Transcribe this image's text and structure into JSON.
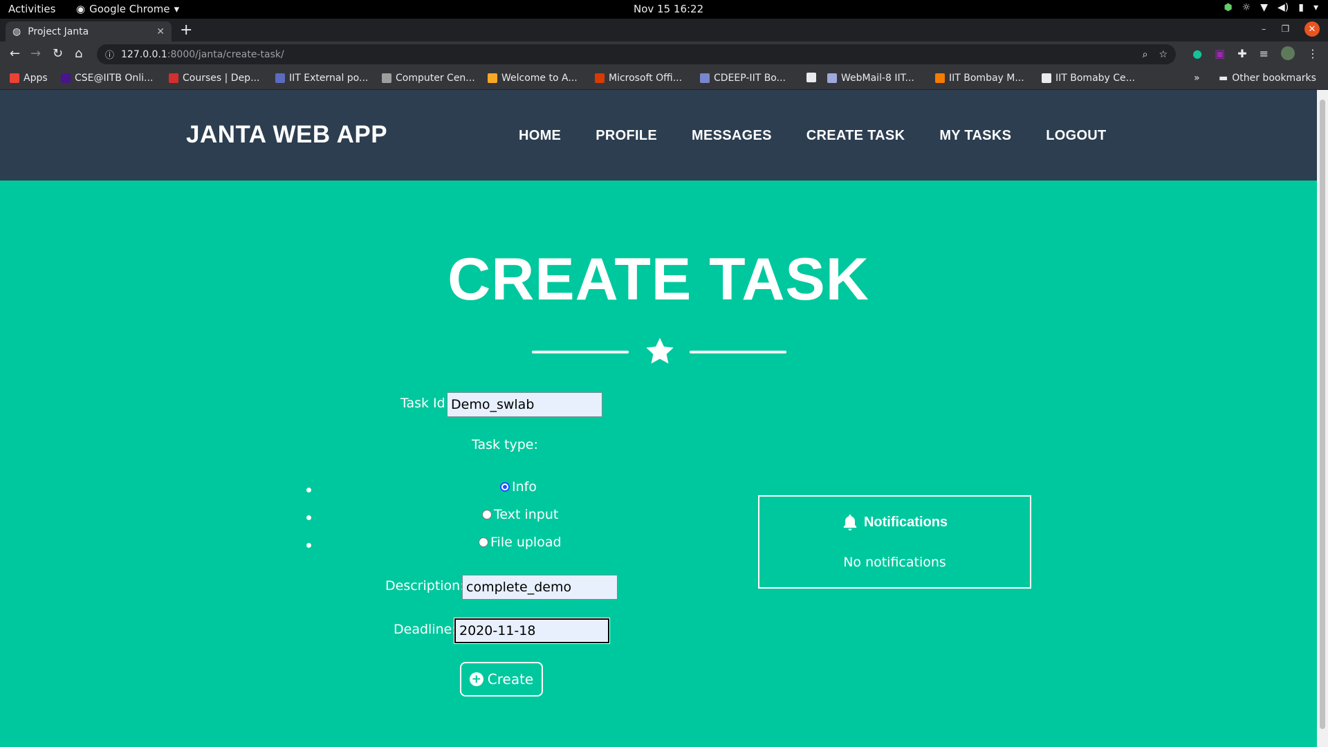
{
  "system": {
    "activities": "Activities",
    "app_name": "Google Chrome",
    "clock": "Nov 15  16:22"
  },
  "browser": {
    "tab_title": "Project Janta",
    "url_host": "127.0.0.1",
    "url_rest": ":8000/janta/create-task/",
    "bookmarks": [
      {
        "label": "Apps",
        "color": "#ea4335"
      },
      {
        "label": "CSE@IITB Onli...",
        "color": "#4a148c"
      },
      {
        "label": "Courses | Dep...",
        "color": "#d32f2f"
      },
      {
        "label": "IIT External po...",
        "color": "#5c6bc0"
      },
      {
        "label": "Computer Cen...",
        "color": "#9e9e9e"
      },
      {
        "label": "Welcome to A...",
        "color": "#f9a825"
      },
      {
        "label": "Microsoft Offi...",
        "color": "#d83b01"
      },
      {
        "label": "CDEEP-IIT Bo...",
        "color": "#7986cb"
      },
      {
        "label": "",
        "color": "#e8eaed"
      },
      {
        "label": "WebMail-8 IIT...",
        "color": "#9fa8da"
      },
      {
        "label": "IIT Bombay M...",
        "color": "#f57c00"
      },
      {
        "label": "IIT Bomaby Ce...",
        "color": "#e8eaed"
      }
    ],
    "more_bookmarks": "»",
    "other_bookmarks": "Other bookmarks"
  },
  "navbar": {
    "brand": "JANTA WEB APP",
    "links": [
      "HOME",
      "PROFILE",
      "MESSAGES",
      "CREATE TASK",
      "MY TASKS",
      "LOGOUT"
    ]
  },
  "page": {
    "heading": "CREATE TASK"
  },
  "form": {
    "task_id_label": "Task Id:",
    "task_id_value": "Demo_swlab",
    "task_type_label": "Task type:",
    "task_types": [
      {
        "label": "Info",
        "checked": true
      },
      {
        "label": "Text input",
        "checked": false
      },
      {
        "label": "File upload",
        "checked": false
      }
    ],
    "description_label": "Description:",
    "description_value": "complete_demo",
    "deadline_label": "Deadline:",
    "deadline_value": "2020-11-18",
    "create_label": "Create"
  },
  "notifications": {
    "title": "Notifications",
    "empty_text": "No notifications"
  },
  "colors": {
    "navbar": "#2c3e50",
    "page_bg": "#00c89e",
    "radio_accent": "#1a53ff"
  }
}
